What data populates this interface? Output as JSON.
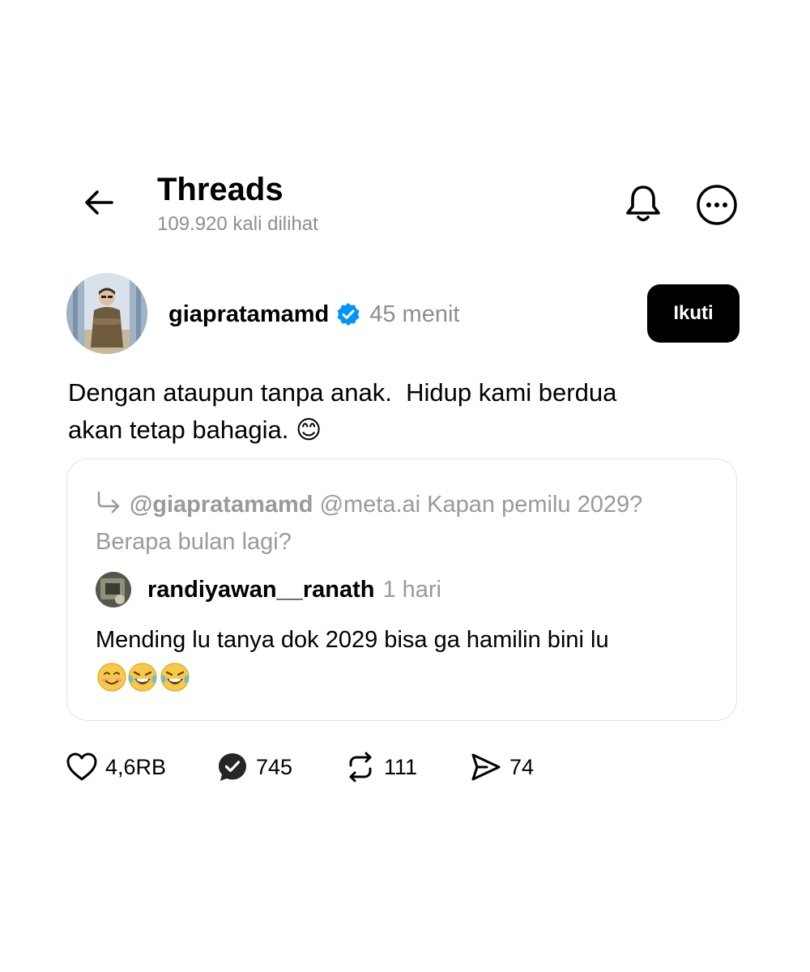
{
  "header": {
    "title": "Threads",
    "views": "109.920 kali dilihat",
    "back_icon": "arrow-left-icon",
    "bell_icon": "bell-icon",
    "more_icon": "more-circle-icon"
  },
  "post": {
    "username": "giapratamamd",
    "verified": true,
    "age": "45 menit",
    "follow_label": "Ikuti",
    "text": "Dengan ataupun tanpa anak.  Hidup kami berdua\nakan tetap bahagia. 😊"
  },
  "quote": {
    "reply_handle": "@giapratamamd",
    "reply_text": " @meta.ai Kapan pemilu 2029? Berapa bulan lagi?",
    "username": "randiyawan__ranath",
    "age": "1 hari",
    "text": "Mending lu tanya dok 2029 bisa ga hamilin bini lu",
    "emojis": "☺️😂😂"
  },
  "actions": {
    "likes": "4,6RB",
    "replies": "745",
    "reposts": "111",
    "shares": "74"
  },
  "colors": {
    "text": "#000000",
    "muted": "#8e8e8e",
    "verified_blue": "#0095f6",
    "follow_bg": "#000000",
    "card_border": "#e3e3e3"
  }
}
